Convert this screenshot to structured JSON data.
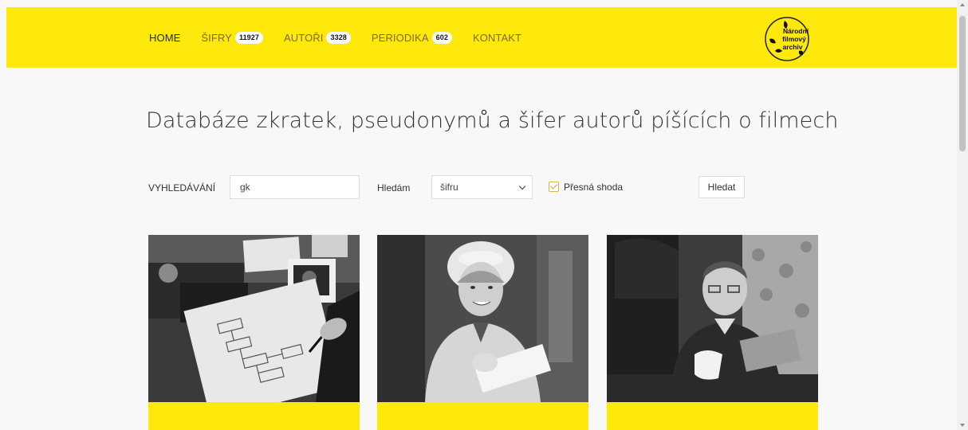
{
  "nav": {
    "items": [
      {
        "label": "HOME",
        "badge": null,
        "active": true
      },
      {
        "label": "ŠIFRY",
        "badge": "11927",
        "active": false
      },
      {
        "label": "AUTOŘI",
        "badge": "3328",
        "active": false
      },
      {
        "label": "PERIODIKA",
        "badge": "602",
        "active": false
      },
      {
        "label": "KONTAKT",
        "badge": null,
        "active": false
      }
    ],
    "logo_text": [
      "Národní",
      "filmový",
      "archiv"
    ]
  },
  "page_title": "Databáze zkratek, pseudonymů a šifer autorů píšících o filmech",
  "search": {
    "label": "VYHLEDÁVÁNÍ",
    "value": "gk",
    "mode_label": "Hledám",
    "mode_selected": "šifru",
    "exact_label": "Přesná shoda",
    "exact_checked": true,
    "submit_label": "Hledat"
  },
  "cards": [
    {
      "image": "notebook-with-diagram-photo-icon"
    },
    {
      "image": "smiling-woman-writing-photo-icon"
    },
    {
      "image": "man-reading-magazine-photo-icon"
    }
  ],
  "colors": {
    "accent": "#ffe80c",
    "background": "#f8f8f8",
    "text": "#333333"
  }
}
